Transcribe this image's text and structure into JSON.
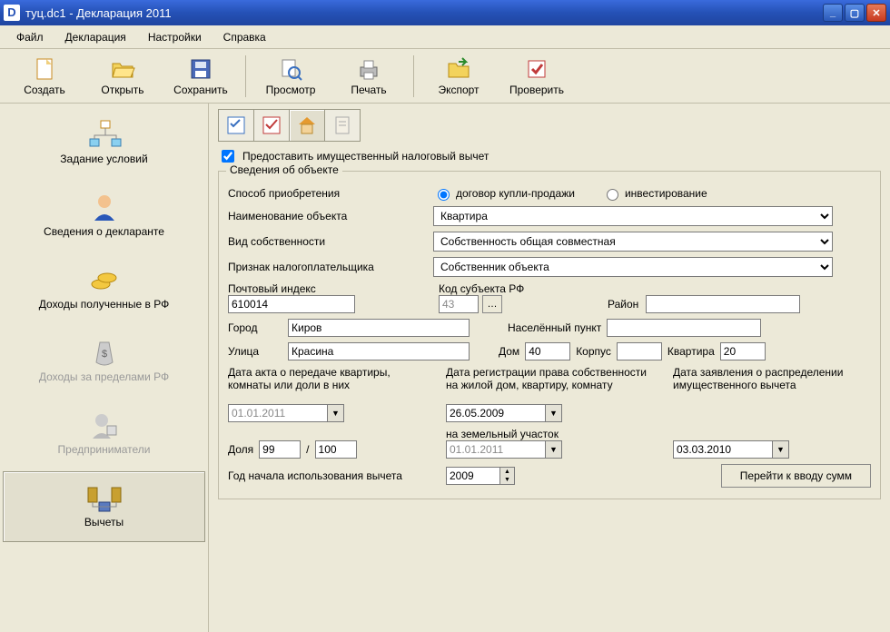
{
  "window": {
    "title": "туц.dc1 - Декларация 2011"
  },
  "menu": {
    "file": "Файл",
    "decl": "Декларация",
    "settings": "Настройки",
    "help": "Справка"
  },
  "toolbar": {
    "create": "Создать",
    "open": "Открыть",
    "save": "Сохранить",
    "preview": "Просмотр",
    "print": "Печать",
    "export": "Экспорт",
    "check": "Проверить"
  },
  "sidebar": {
    "conditions": "Задание условий",
    "declarant": "Сведения о декларанте",
    "income_rf": "Доходы полученные в РФ",
    "income_abroad": "Доходы за пределами РФ",
    "entrepreneur": "Предприниматели",
    "deductions": "Вычеты"
  },
  "form": {
    "provide_checkbox": "Предоставить имущественный налоговый вычет",
    "group_title": "Сведения об объекте",
    "acq_label": "Способ приобретения",
    "acq_opt1": "договор купли-продажи",
    "acq_opt2": "инвестирование",
    "obj_name_label": "Наименование объекта",
    "obj_name_value": "Квартира",
    "ownership_label": "Вид собственности",
    "ownership_value": "Собственность общая совместная",
    "taxpayer_label": "Признак налогоплательщика",
    "taxpayer_value": "Собственник объекта",
    "postal_label": "Почтовый индекс",
    "postal_value": "610014",
    "region_code_label": "Код субъекта РФ",
    "region_code_value": "43",
    "district_label": "Район",
    "district_value": "",
    "city_label": "Город",
    "city_value": "Киров",
    "settlement_label": "Населённый пункт",
    "settlement_value": "",
    "street_label": "Улица",
    "street_value": "Красина",
    "house_label": "Дом",
    "house_value": "40",
    "building_label": "Корпус",
    "building_value": "",
    "apt_label": "Квартира",
    "apt_value": "20",
    "date_act_label": "Дата акта о передаче квартиры, комнаты или доли в них",
    "date_act_value": "01.01.2011",
    "date_reg_label": "Дата регистрации права собственности на жилой дом, квартиру, комнату",
    "date_reg_value": "26.05.2009",
    "date_claim_label": "Дата заявления о распределении имущественного вычета",
    "date_claim_value": "03.03.2010",
    "land_label": "на земельный участок",
    "land_date_value": "01.01.2011",
    "share_label": "Доля",
    "share_num": "99",
    "share_den": "100",
    "share_sep": "/",
    "year_label": "Год начала использования вычета",
    "year_value": "2009",
    "goto_button": "Перейти к вводу сумм"
  }
}
